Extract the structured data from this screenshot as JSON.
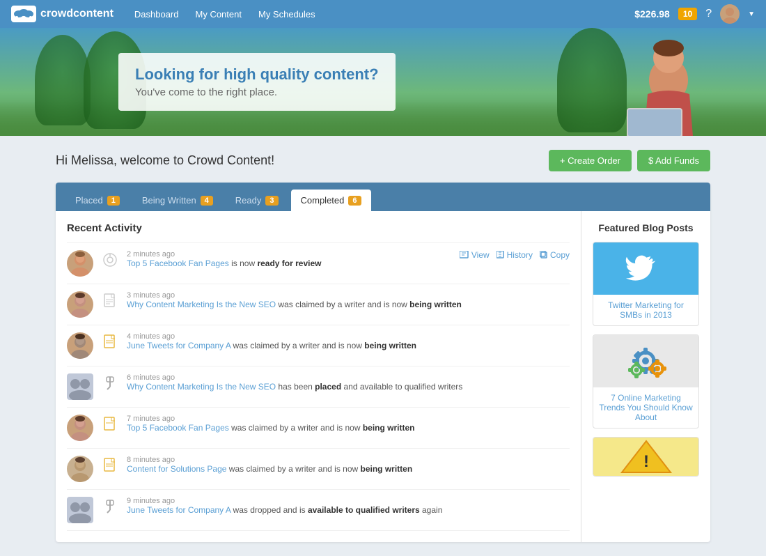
{
  "nav": {
    "logo_text": "crowdcontent",
    "links": [
      "Dashboard",
      "My Content",
      "My Schedules"
    ],
    "balance": "$226.98",
    "notification_count": "10",
    "help_label": "?"
  },
  "hero": {
    "heading": "Looking for high quality content?",
    "subheading": "You've come to the right place."
  },
  "welcome": {
    "text": "Hi Melissa, welcome to Crowd Content!",
    "create_order": "+ Create Order",
    "add_funds": "$ Add Funds"
  },
  "tabs": [
    {
      "label": "Placed",
      "badge": "1",
      "active": false
    },
    {
      "label": "Being Written",
      "badge": "4",
      "active": false
    },
    {
      "label": "Ready",
      "badge": "3",
      "active": false
    },
    {
      "label": "Completed",
      "badge": "6",
      "active": true
    }
  ],
  "activity": {
    "title": "Recent Activity",
    "items": [
      {
        "time": "2 minutes ago",
        "link_text": "Top 5 Facebook Fan Pages",
        "text_suffix": " is now ",
        "status": "ready for review",
        "has_actions": true,
        "actions": [
          "View",
          "History",
          "Copy"
        ],
        "avatar_type": "person1",
        "doc_type": "search"
      },
      {
        "time": "3 minutes ago",
        "link_text": "Why Content Marketing Is the New SEO",
        "text_suffix": " was claimed by a writer and is now ",
        "status": "being written",
        "has_actions": false,
        "avatar_type": "person2",
        "doc_type": "doc"
      },
      {
        "time": "4 minutes ago",
        "link_text": "June Tweets for Company A",
        "text_suffix": " was claimed by a writer and is now ",
        "status": "being written",
        "has_actions": false,
        "avatar_type": "person3",
        "doc_type": "doc"
      },
      {
        "time": "6 minutes ago",
        "link_text": "Why Content Marketing Is the New SEO",
        "text_suffix": " has been ",
        "status": "placed",
        "text_suffix2": " and available to qualified writers",
        "has_actions": false,
        "avatar_type": "group",
        "doc_type": "pin"
      },
      {
        "time": "7 minutes ago",
        "link_text": "Top 5 Facebook Fan Pages",
        "text_suffix": " was claimed by a writer and is now ",
        "status": "being written",
        "has_actions": false,
        "avatar_type": "person2",
        "doc_type": "doc"
      },
      {
        "time": "8 minutes ago",
        "link_text": "Content for Solutions Page",
        "text_suffix": " was claimed by a writer and is now ",
        "status": "being written",
        "has_actions": false,
        "avatar_type": "person4",
        "doc_type": "doc"
      },
      {
        "time": "9 minutes ago",
        "link_text": "June Tweets for Company A",
        "text_suffix": " was dropped and is ",
        "status": "available to qualified writers",
        "text_suffix2": " again",
        "has_actions": false,
        "avatar_type": "group",
        "doc_type": "pin"
      }
    ]
  },
  "sidebar": {
    "title": "Featured Blog Posts",
    "posts": [
      {
        "image_type": "twitter",
        "link_text": "Twitter Marketing for SMBs in 2013"
      },
      {
        "image_type": "gears",
        "link_text": "7 Online Marketing Trends You Should Know About"
      },
      {
        "image_type": "warning",
        "link_text": ""
      }
    ]
  }
}
